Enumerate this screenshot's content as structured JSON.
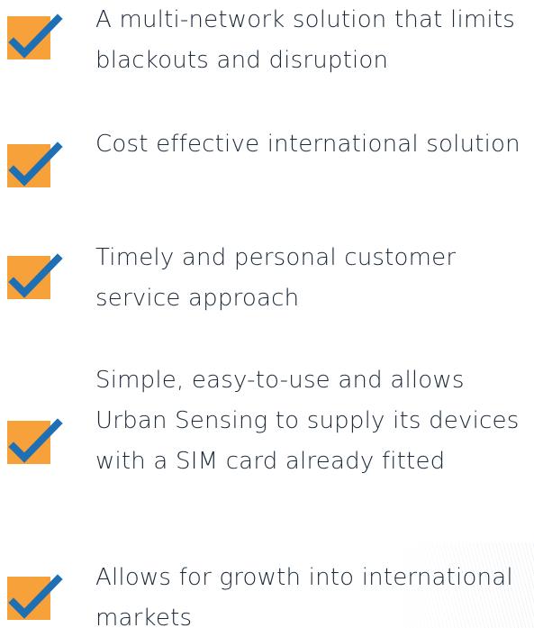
{
  "benefits": [
    {
      "text": "A multi-network solution that limits blackouts and disruption",
      "icon": "checkmark-icon"
    },
    {
      "text": "Cost effective international solution",
      "icon": "checkmark-icon"
    },
    {
      "text": "Timely and personal customer service approach",
      "icon": "checkmark-icon"
    },
    {
      "text": "Simple, easy-to-use and allows Urban Sensing to supply its devices with a SIM card already fitted",
      "icon": "checkmark-icon"
    },
    {
      "text": "Allows for growth into international markets",
      "icon": "checkmark-icon"
    }
  ],
  "colors": {
    "check_box": "#f6a13a",
    "check_mark": "#1f6fb5",
    "text": "#1c2a3a"
  }
}
